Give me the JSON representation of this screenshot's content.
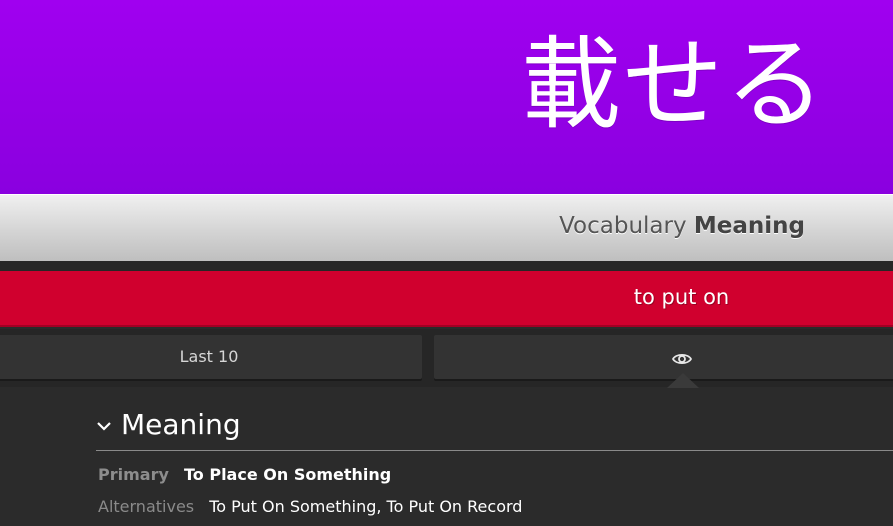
{
  "item": {
    "word": "載せる",
    "type_prefix": "Vocabulary",
    "type_suffix": "Meaning",
    "user_answer": "to put on"
  },
  "buttons": {
    "last10_label": "Last 10",
    "reveal_icon": "eye-icon"
  },
  "meaning_section": {
    "title": "Meaning",
    "primary_label": "Primary",
    "primary_value": "To Place On Something",
    "alternatives_label": "Alternatives",
    "alternatives_value": "To Put On Something, To Put On Record"
  },
  "colors": {
    "vocab_purple": "#9400e6",
    "incorrect_red": "#d0002e",
    "background_dark": "#2b2b2b"
  }
}
